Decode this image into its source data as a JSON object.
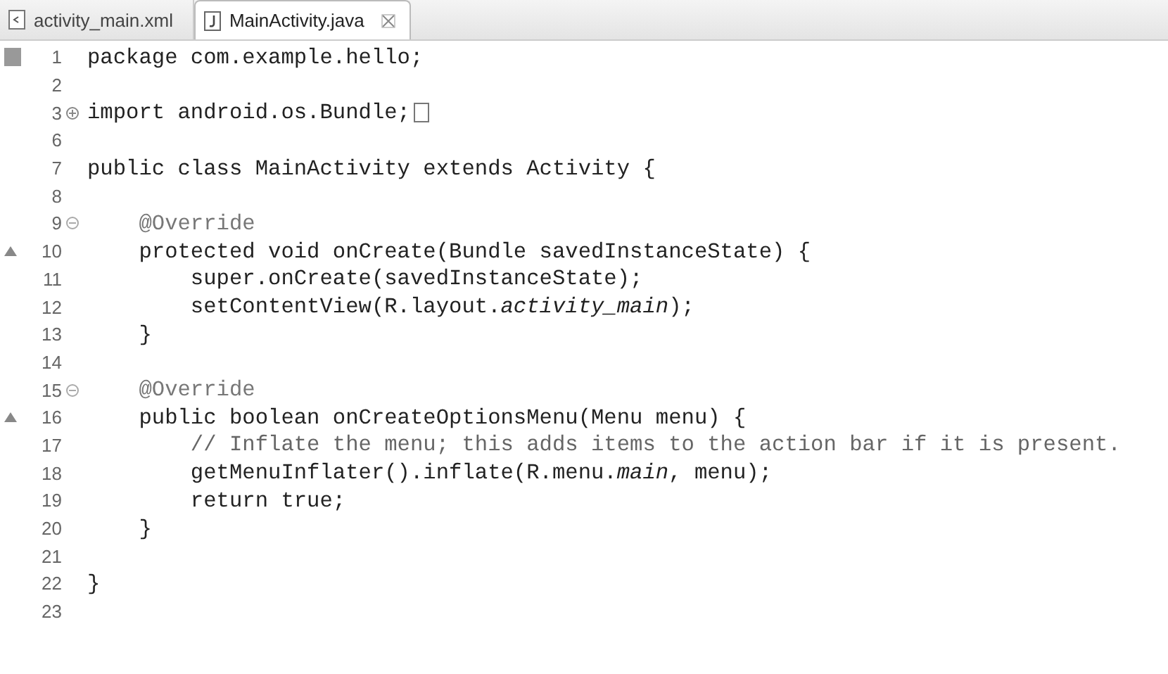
{
  "tabs": [
    {
      "label": "activity_main.xml",
      "kind": "xml",
      "selected": false
    },
    {
      "label": "MainActivity.java",
      "kind": "java",
      "selected": true
    }
  ],
  "lines": [
    {
      "number": "1",
      "marker": {
        "kind": "bookmark"
      },
      "kind": "code",
      "code": "package com.example.hello;"
    },
    {
      "number": "2"
    },
    {
      "number": "3",
      "marker": {
        "kind": "fold-plus"
      },
      "kind": "code",
      "code": "import android.os.Bundle;",
      "folded": true
    },
    {
      "number": "6"
    },
    {
      "number": "7",
      "kind": "code",
      "code": "public class MainActivity extends Activity {"
    },
    {
      "number": "8"
    },
    {
      "number": "9",
      "marker": {
        "kind": "fold-minus"
      },
      "kind": "annotation",
      "code": "    @Override"
    },
    {
      "number": "10",
      "marker": {
        "kind": "override"
      },
      "kind": "code",
      "code": "    protected void onCreate(Bundle savedInstanceState) {"
    },
    {
      "number": "11",
      "kind": "code",
      "code": "        super.onCreate(savedInstanceState);"
    },
    {
      "number": "12",
      "kind": "code",
      "code": "        setContentView(R.layout.*activity_main*);"
    },
    {
      "number": "13",
      "kind": "code",
      "code": "    }"
    },
    {
      "number": "14"
    },
    {
      "number": "15",
      "marker": {
        "kind": "fold-minus"
      },
      "kind": "annotation",
      "code": "    @Override"
    },
    {
      "number": "16",
      "marker": {
        "kind": "override"
      },
      "kind": "code",
      "code": "    public boolean onCreateOptionsMenu(Menu menu) {"
    },
    {
      "number": "17",
      "kind": "comment",
      "code": "        // Inflate the menu; this adds items to the action bar if it is present."
    },
    {
      "number": "18",
      "kind": "code",
      "code": "        getMenuInflater().inflate(R.menu.*main*, menu);"
    },
    {
      "number": "19",
      "kind": "code",
      "code": "        return true;"
    },
    {
      "number": "20",
      "kind": "code",
      "code": "    }"
    },
    {
      "number": "21"
    },
    {
      "number": "22",
      "kind": "code",
      "code": "}"
    },
    {
      "number": "23"
    }
  ]
}
